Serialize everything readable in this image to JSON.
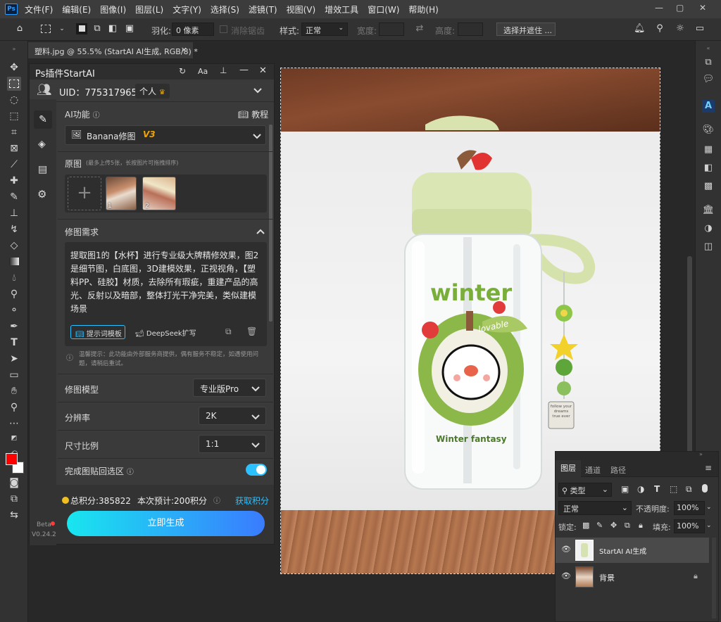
{
  "menubar": {
    "logo": "Ps",
    "items": [
      "文件(F)",
      "编辑(E)",
      "图像(I)",
      "图层(L)",
      "文字(Y)",
      "选择(S)",
      "滤镜(T)",
      "视图(V)",
      "增效工具",
      "窗口(W)",
      "帮助(H)"
    ]
  },
  "options": {
    "feather_label": "羽化:",
    "feather_value": "0 像素",
    "antialias_label": "消除锯齿",
    "style_label": "样式:",
    "style_value": "正常",
    "width_label": "宽度:",
    "height_label": "高度:",
    "select_mask_label": "选择并遮住 ..."
  },
  "document": {
    "tab_title": "塑料.jpg @ 55.5% (StartAI AI生成, RGB/8) *",
    "close": "×"
  },
  "plugin": {
    "title": "Ps插件StartAI",
    "uid_label": "UID：775317965",
    "account_type": "个人",
    "ai_func_label": "AI功能",
    "tutorial_label": "教程",
    "func_select": "Banana修图",
    "func_version": "V3",
    "original_label": "原图",
    "original_hint": "(最多上传5张，长按图片可拖拽排序)",
    "thumb1_index": "1",
    "thumb2_index": "2",
    "requirement_label": "修图需求",
    "requirement_text": "提取图1的【水杯】进行专业级大牌精修效果，图2是细节图，白底图，3D建模效果，正视视角，【塑料PP、硅胶】材质，去除所有瑕疵，重建产品的高光、反射以及暗部，整体打光干净完美，类似建模场景",
    "prompt_template_btn": "提示词模板",
    "deepseek_btn": "DeepSeek扩写",
    "notice": "温馨提示：此功能由外部服务商提供，偶有服务不稳定，如遇使用问题，请稍后重试。",
    "model_label": "修图模型",
    "model_value": "专业版Pro",
    "resolution_label": "分辨率",
    "resolution_value": "2K",
    "ratio_label": "尺寸比例",
    "ratio_value": "1:1",
    "paste_back_label": "完成图贴回选区",
    "paste_back_on": true,
    "points_total": "总积分:385822",
    "points_cost": "本次预计:200积分",
    "get_points": "获取积分",
    "generate_btn": "立即生成",
    "beta": "Beta",
    "version": "V0.24.2"
  },
  "product": {
    "brand_text": "winter",
    "tag_text": "lovable",
    "bottom_text": "Winter fantasy",
    "charm_text": "follow your dreams true ever"
  },
  "layers": {
    "tabs": [
      "图层",
      "通道",
      "路径"
    ],
    "filter_kind": "类型",
    "blend_mode": "正常",
    "opacity_label": "不透明度:",
    "opacity_value": "100%",
    "lock_label": "锁定:",
    "fill_label": "填充:",
    "fill_value": "100%",
    "items": [
      {
        "name": "StartAI AI生成"
      },
      {
        "name": "背景"
      }
    ]
  },
  "colors": {
    "accent": "#2bc0ff",
    "gradient_start": "#18e6ef",
    "gradient_end": "#3a7bff",
    "fg_color": "#ff0000",
    "bg_color": "#ffffff",
    "version_gold": "#f0a500"
  }
}
